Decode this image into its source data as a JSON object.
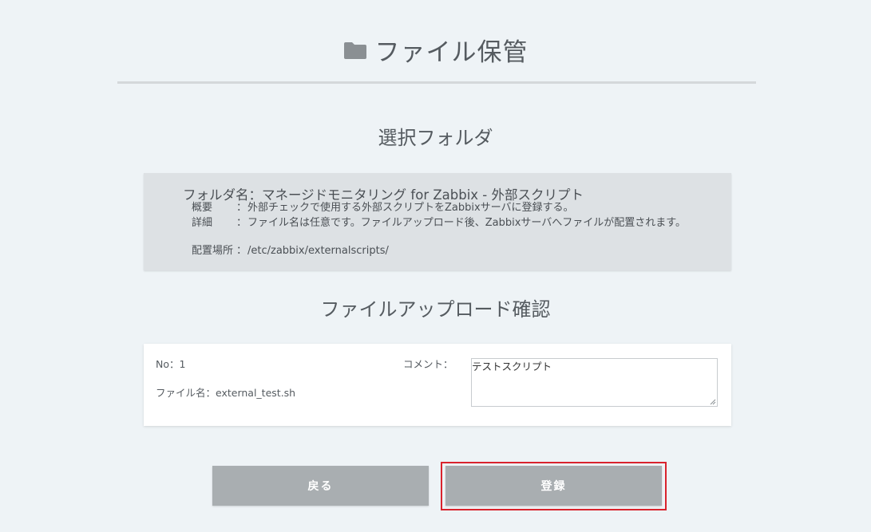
{
  "header": {
    "title": "ファイル保管",
    "icon": "folder-icon"
  },
  "selected_folder": {
    "section_title": "選択フォルダ",
    "folder_name_label": "フォルダ名：",
    "folder_name": "マネージドモニタリング for Zabbix - 外部スクリプト",
    "rows": [
      {
        "label": "概要",
        "sep": "：",
        "value": "外部チェックで使用する外部スクリプトをZabbixサーバに登録する。"
      },
      {
        "label": "詳細",
        "sep": "：",
        "value": "ファイル名は任意です。ファイルアップロード後、Zabbixサーバへファイルが配置されます。"
      },
      {
        "label": "配置場所",
        "sep": "：",
        "value": "/etc/zabbix/externalscripts/"
      }
    ]
  },
  "upload_confirm": {
    "section_title": "ファイルアップロード確認",
    "no_label": "No：1",
    "filename_label": "ファイル名：external_test.sh",
    "comment_label": "コメント：",
    "comment_value": "テストスクリプト"
  },
  "actions": {
    "back_label": "戻る",
    "register_label": "登録",
    "highlight_color": "#d9232d",
    "button_color": "#a9aeb1"
  }
}
